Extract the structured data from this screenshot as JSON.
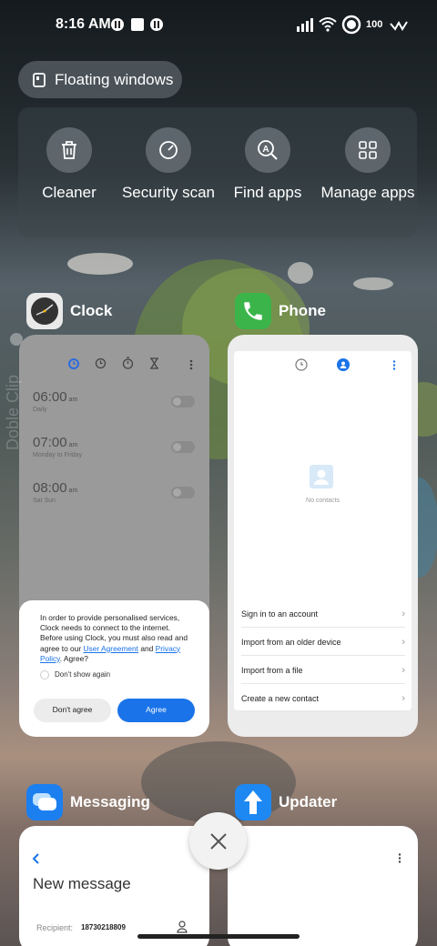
{
  "status": {
    "time": "8:16 AM",
    "battery": "100"
  },
  "recents": {
    "floating_windows_label": "Floating windows",
    "quick_actions": [
      {
        "label": "Cleaner",
        "icon": "trash-icon"
      },
      {
        "label": "Security scan",
        "icon": "shield-gauge-icon"
      },
      {
        "label": "Find apps",
        "icon": "search-app-icon"
      },
      {
        "label": "Manage apps",
        "icon": "grid-icon"
      }
    ],
    "apps": [
      {
        "name": "Clock",
        "icon": "clock-app-icon"
      },
      {
        "name": "Phone",
        "icon": "phone-app-icon"
      },
      {
        "name": "Messaging",
        "icon": "messaging-app-icon"
      },
      {
        "name": "Updater",
        "icon": "updater-app-icon"
      }
    ]
  },
  "clock_preview": {
    "alarms": [
      {
        "time": "06:00",
        "ampm": "am",
        "days": "Daily"
      },
      {
        "time": "07:00",
        "ampm": "am",
        "days": "Monday to Friday"
      },
      {
        "time": "08:00",
        "ampm": "am",
        "days": "Sat Sun"
      }
    ],
    "dialog": {
      "text_before": "In order to provide personalised services, Clock needs to connect to the internet. Before using Clock, you must also read and agree to our",
      "link1": "User Agreement",
      "and": "and",
      "link2": "Privacy Policy",
      "text_after": ". Agree?",
      "checkbox_label": "Don't show again",
      "disagree": "Don't agree",
      "agree": "Agree"
    },
    "watermark": "Doble Clip"
  },
  "phone_preview": {
    "empty_label": "No contacts",
    "options": [
      "Sign in to an account",
      "Import from an older device",
      "Import from a file",
      "Create a new contact"
    ]
  },
  "messaging_preview": {
    "title": "New message",
    "recipient_label": "Recipient:",
    "recipient_value": "18730218809"
  },
  "colors": {
    "accent_blue": "#1a73e8",
    "phone_green": "#3bb54a",
    "messaging_blue": "#1b7ff0",
    "updater_blue": "#1e88f2"
  }
}
